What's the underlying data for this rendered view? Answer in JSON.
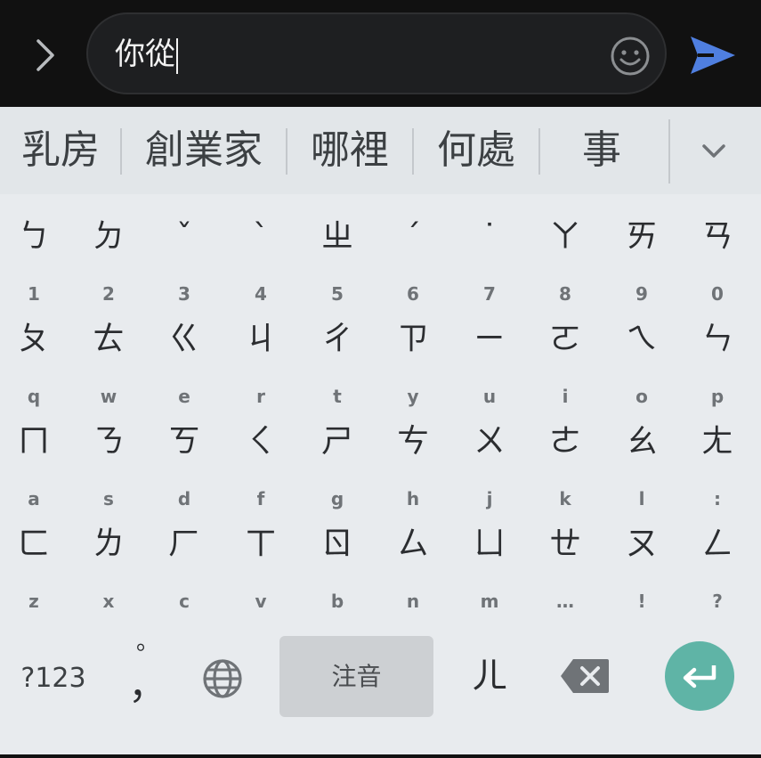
{
  "compose": {
    "input_value": "你從",
    "icons": {
      "expand": "chevron-right-icon",
      "emoji": "emoji-smile-icon",
      "send": "send-arrow-icon"
    },
    "accent_color": "#4f7fe0"
  },
  "suggestions": {
    "items": [
      "乳房",
      "創業家",
      "哪裡",
      "何處",
      "事"
    ],
    "expand_icon": "chevron-down-icon"
  },
  "keyboard": {
    "rows": [
      [
        {
          "main": "ㄅ",
          "sub": "1"
        },
        {
          "main": "ㄉ",
          "sub": "2"
        },
        {
          "main": "ˇ",
          "sub": "3"
        },
        {
          "main": "ˋ",
          "sub": "4"
        },
        {
          "main": "ㄓ",
          "sub": "5"
        },
        {
          "main": "ˊ",
          "sub": "6"
        },
        {
          "main": "˙",
          "sub": "7"
        },
        {
          "main": "ㄚ",
          "sub": "8"
        },
        {
          "main": "ㄞ",
          "sub": "9"
        },
        {
          "main": "ㄢ",
          "sub": "0"
        }
      ],
      [
        {
          "main": "ㄆ",
          "sub": "q"
        },
        {
          "main": "ㄊ",
          "sub": "w"
        },
        {
          "main": "ㄍ",
          "sub": "e"
        },
        {
          "main": "ㄐ",
          "sub": "r"
        },
        {
          "main": "ㄔ",
          "sub": "t"
        },
        {
          "main": "ㄗ",
          "sub": "y"
        },
        {
          "main": "ㄧ",
          "sub": "u"
        },
        {
          "main": "ㄛ",
          "sub": "i"
        },
        {
          "main": "ㄟ",
          "sub": "o"
        },
        {
          "main": "ㄣ",
          "sub": "p"
        }
      ],
      [
        {
          "main": "ㄇ",
          "sub": "a"
        },
        {
          "main": "ㄋ",
          "sub": "s"
        },
        {
          "main": "ㄎ",
          "sub": "d"
        },
        {
          "main": "ㄑ",
          "sub": "f"
        },
        {
          "main": "ㄕ",
          "sub": "g"
        },
        {
          "main": "ㄘ",
          "sub": "h"
        },
        {
          "main": "ㄨ",
          "sub": "j"
        },
        {
          "main": "ㄜ",
          "sub": "k"
        },
        {
          "main": "ㄠ",
          "sub": "l"
        },
        {
          "main": "ㄤ",
          "sub": ":"
        }
      ],
      [
        {
          "main": "ㄈ",
          "sub": "z"
        },
        {
          "main": "ㄌ",
          "sub": "x"
        },
        {
          "main": "ㄏ",
          "sub": "c"
        },
        {
          "main": "ㄒ",
          "sub": "v"
        },
        {
          "main": "ㄖ",
          "sub": "b"
        },
        {
          "main": "ㄙ",
          "sub": "n"
        },
        {
          "main": "ㄩ",
          "sub": "m"
        },
        {
          "main": "ㄝ",
          "sub": "…"
        },
        {
          "main": "ㄡ",
          "sub": "!"
        },
        {
          "main": "ㄥ",
          "sub": "?"
        }
      ]
    ],
    "bottom": {
      "symbols_label": "?123",
      "punct_top": "。",
      "punct_bottom": "，",
      "globe_icon": "globe-icon",
      "space_label": "注音",
      "er_label": "ㄦ",
      "delete_icon": "backspace-icon",
      "enter_icon": "enter-return-icon",
      "enter_color": "#5fb4a6"
    }
  }
}
